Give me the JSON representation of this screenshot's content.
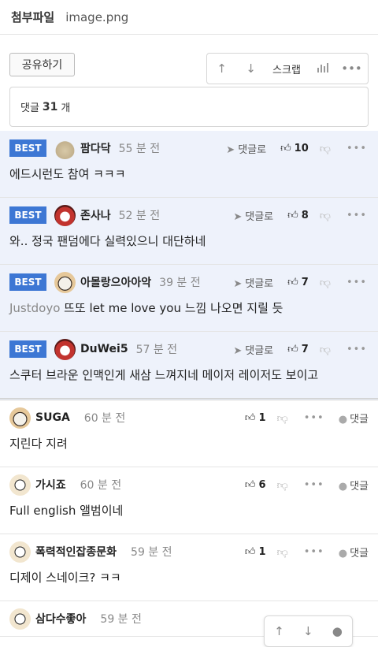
{
  "attachment": {
    "label": "첨부파일",
    "filename": "image.png"
  },
  "toolbar": {
    "share_label": "공유하기",
    "scrap_label": "스크랩",
    "up_icon": "↑",
    "down_icon": "↓",
    "more_icon": "•••"
  },
  "comment_count": {
    "prefix": "댓글",
    "count": "31",
    "suffix": "개"
  },
  "best_label": "BEST",
  "reply_label": "댓글로",
  "reply_label_short": "댓글",
  "best_comments": [
    {
      "nick": "팜다닥",
      "time": "55 분 전",
      "likes": "10",
      "text": "에드시런도 참여 ㅋㅋㅋ",
      "prefix": "",
      "avatar": "av-blob"
    },
    {
      "nick": "존사나",
      "time": "52 분 전",
      "likes": "8",
      "text": "와.. 정국 팬덤에다 실력있으니 대단하네",
      "prefix": "",
      "avatar": "av-red"
    },
    {
      "nick": "아몰랑으아아악",
      "time": "39 분 전",
      "likes": "7",
      "text": "뜨또 let me love you 느낌 나오면 지릴 듯",
      "prefix": "Justdoyo",
      "avatar": "av-dog"
    },
    {
      "nick": "DuWei5",
      "time": "57 분 전",
      "likes": "7",
      "text": "스쿠터 브라운 인맥인게 새삼 느껴지네 메이저 레이저도 보이고",
      "prefix": "",
      "avatar": "av-red"
    }
  ],
  "comments": [
    {
      "nick": "SUGA",
      "time": "60 분 전",
      "likes": "1",
      "text": "지린다 지려",
      "avatar": "av-dog"
    },
    {
      "nick": "가시죠",
      "time": "60 분 전",
      "likes": "6",
      "text": "Full english 앨범이네",
      "avatar": "av-puppy"
    },
    {
      "nick": "폭력적인잡종문화",
      "time": "59 분 전",
      "likes": "1",
      "text": "디제이 스네이크? ㅋㅋ",
      "avatar": "av-puppy"
    },
    {
      "nick": "삼다수좋아",
      "time": "59 분 전",
      "likes": "",
      "text": "",
      "avatar": "av-puppy"
    }
  ],
  "colors": {
    "accent": "#3d77d4",
    "best_bg": "#eef2fb"
  }
}
